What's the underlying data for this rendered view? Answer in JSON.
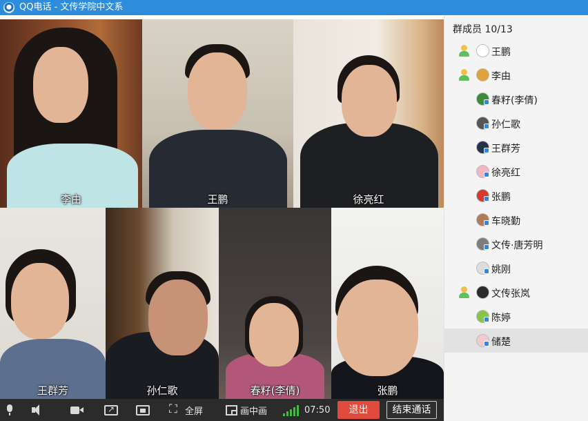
{
  "window": {
    "title": "QQ电话 - 文传学院中文系"
  },
  "video_tiles": [
    {
      "name": "李由"
    },
    {
      "name": "王鹏"
    },
    {
      "name": "徐亮红"
    },
    {
      "name": "王群芳"
    },
    {
      "name": "孙仁歌"
    },
    {
      "name": "春籽(李倩)"
    },
    {
      "name": "张鹏"
    }
  ],
  "sidebar": {
    "header": "群成员 10/13",
    "members": [
      {
        "name": "王鹏",
        "speaking": true,
        "avatar_color": "#ffffff",
        "selected": false
      },
      {
        "name": "李由",
        "speaking": true,
        "avatar_color": "#e0a23a",
        "selected": false
      },
      {
        "name": "春籽(李倩)",
        "speaking": false,
        "avatar_color": "#3d8a3d",
        "selected": false
      },
      {
        "name": "孙仁歌",
        "speaking": false,
        "avatar_color": "#555555",
        "selected": false
      },
      {
        "name": "王群芳",
        "speaking": false,
        "avatar_color": "#23314a",
        "selected": false
      },
      {
        "name": "徐亮红",
        "speaking": false,
        "avatar_color": "#f1b6c3",
        "selected": false
      },
      {
        "name": "张鹏",
        "speaking": false,
        "avatar_color": "#d43b2a",
        "selected": false
      },
      {
        "name": "车晓勤",
        "speaking": false,
        "avatar_color": "#b07b56",
        "selected": false
      },
      {
        "name": "文传·唐芳明",
        "speaking": false,
        "avatar_color": "#7d7d7d",
        "selected": false
      },
      {
        "name": "姚刚",
        "speaking": false,
        "avatar_color": "#dddddd",
        "selected": false
      },
      {
        "name": "文传张岚",
        "speaking": true,
        "avatar_color": "#2c2c2c",
        "selected": false
      },
      {
        "name": "陈婷",
        "speaking": false,
        "avatar_color": "#8bc34a",
        "selected": false
      },
      {
        "name": "储楚",
        "speaking": false,
        "avatar_color": "#f3c8cf",
        "selected": true
      }
    ]
  },
  "toolbar": {
    "fullscreen_label": "全屏",
    "pip_label": "画中画",
    "duration": "07:50",
    "hangup_label": "退出",
    "end_call_label": "结束通话"
  },
  "colors": {
    "titlebar": "#2d8cdc",
    "hangup": "#e14b3b",
    "signal": "#3fbf3f"
  }
}
